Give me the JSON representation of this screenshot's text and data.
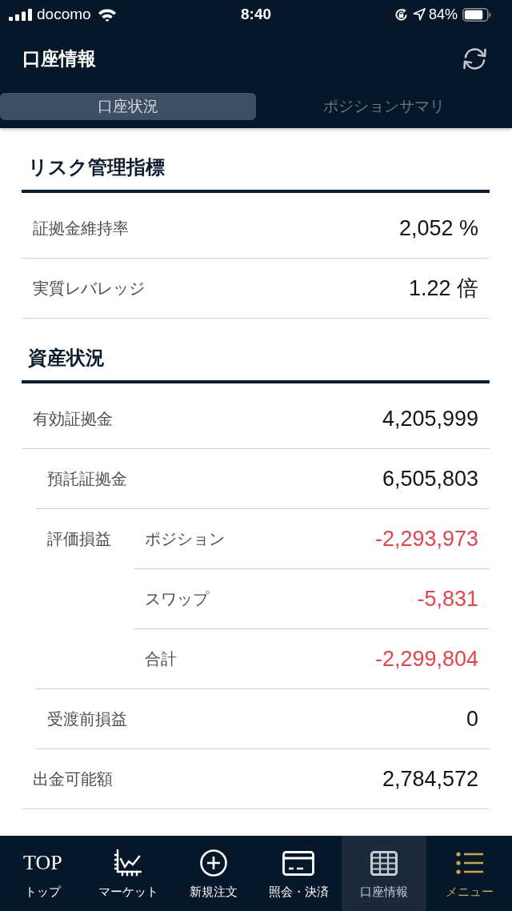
{
  "status_bar": {
    "carrier": "docomo",
    "time": "8:40",
    "battery": "84%"
  },
  "header": {
    "title": "口座情報"
  },
  "tabs": [
    {
      "label": "口座状況",
      "selected": true
    },
    {
      "label": "ポジションサマリ",
      "selected": false
    }
  ],
  "sections": [
    {
      "title": "リスク管理指標",
      "rows": [
        {
          "label": "証拠金維持率",
          "value": "2,052 %",
          "negative": false
        },
        {
          "label": "実質レバレッジ",
          "value": "1.22 倍",
          "negative": false
        }
      ]
    },
    {
      "title": "資産状況",
      "rows": [
        {
          "label": "有効証拠金",
          "value": "4,205,999",
          "negative": false,
          "children": [
            {
              "label": "預託証拠金",
              "value": "6,505,803",
              "negative": false
            },
            {
              "label": "評価損益",
              "children": [
                {
                  "label": "ポジション",
                  "value": "-2,293,973",
                  "negative": true
                },
                {
                  "label": "スワップ",
                  "value": "-5,831",
                  "negative": true
                },
                {
                  "label": "合計",
                  "value": "-2,299,804",
                  "negative": true
                }
              ]
            },
            {
              "label": "受渡前損益",
              "value": "0",
              "negative": false
            }
          ]
        },
        {
          "label": "出金可能額",
          "value": "2,784,572",
          "negative": false
        }
      ]
    }
  ],
  "bottom_nav": [
    {
      "kind": "top",
      "icon_text": "TOP",
      "label": "トップ",
      "selected": false,
      "color": "#ffffff"
    },
    {
      "kind": "chart",
      "label": "マーケット",
      "selected": false,
      "color": "#ffffff"
    },
    {
      "kind": "plus",
      "label": "新規注文",
      "selected": false,
      "color": "#ffffff"
    },
    {
      "kind": "card",
      "label": "照会・決済",
      "selected": false,
      "color": "#ffffff"
    },
    {
      "kind": "grid",
      "label": "口座情報",
      "selected": true,
      "color": "#c6cbd1"
    },
    {
      "kind": "menu",
      "label": "メニュー",
      "selected": false,
      "color": "#c9a654"
    }
  ]
}
